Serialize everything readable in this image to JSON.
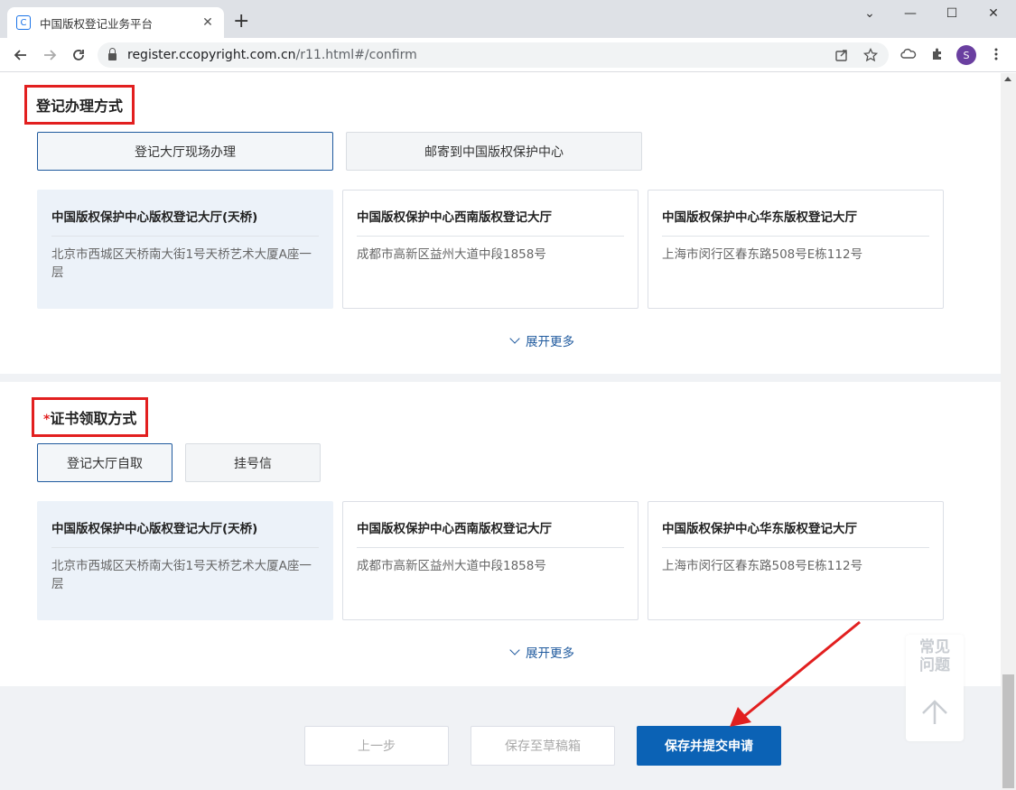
{
  "browser": {
    "tab_title": "中国版权登记业务平台",
    "tab_favicon": "C",
    "tab_close": "✕",
    "new_tab": "+",
    "url_host": "register.ccopyright.com.cn",
    "url_path": "/r11.html#/confirm",
    "profile_initial": "S",
    "window_controls": [
      "⌄",
      "—",
      "☐",
      "✕"
    ]
  },
  "registration_method": {
    "title": "登记办理方式",
    "options": [
      {
        "label": "登记大厅现场办理",
        "active": true
      },
      {
        "label": "邮寄到中国版权保护中心",
        "active": false
      }
    ],
    "halls": [
      {
        "name": "中国版权保护中心版权登记大厅(天桥)",
        "address": "北京市西城区天桥南大街1号天桥艺术大厦A座一层",
        "selected": true
      },
      {
        "name": "中国版权保护中心西南版权登记大厅",
        "address": "成都市高新区益州大道中段1858号",
        "selected": false
      },
      {
        "name": "中国版权保护中心华东版权登记大厅",
        "address": "上海市闵行区春东路508号E栋112号",
        "selected": false
      }
    ],
    "more_label": "展开更多"
  },
  "certificate_method": {
    "required_mark": "*",
    "title": "证书领取方式",
    "options": [
      {
        "label": "登记大厅自取",
        "active": true
      },
      {
        "label": "挂号信",
        "active": false
      }
    ],
    "halls": [
      {
        "name": "中国版权保护中心版权登记大厅(天桥)",
        "address": "北京市西城区天桥南大街1号天桥艺术大厦A座一层",
        "selected": true
      },
      {
        "name": "中国版权保护中心西南版权登记大厅",
        "address": "成都市高新区益州大道中段1858号",
        "selected": false
      },
      {
        "name": "中国版权保护中心华东版权登记大厅",
        "address": "上海市闵行区春东路508号E栋112号",
        "selected": false
      }
    ],
    "more_label": "展开更多"
  },
  "faq": {
    "label_line1": "常见",
    "label_line2": "问题"
  },
  "footer": {
    "prev_label": "上一步",
    "draft_label": "保存至草稿箱",
    "submit_label": "保存并提交申请"
  },
  "colors": {
    "accent": "#0b62b5",
    "highlight_border": "#e21f1f",
    "selected_card_bg": "#ecf2f9"
  }
}
